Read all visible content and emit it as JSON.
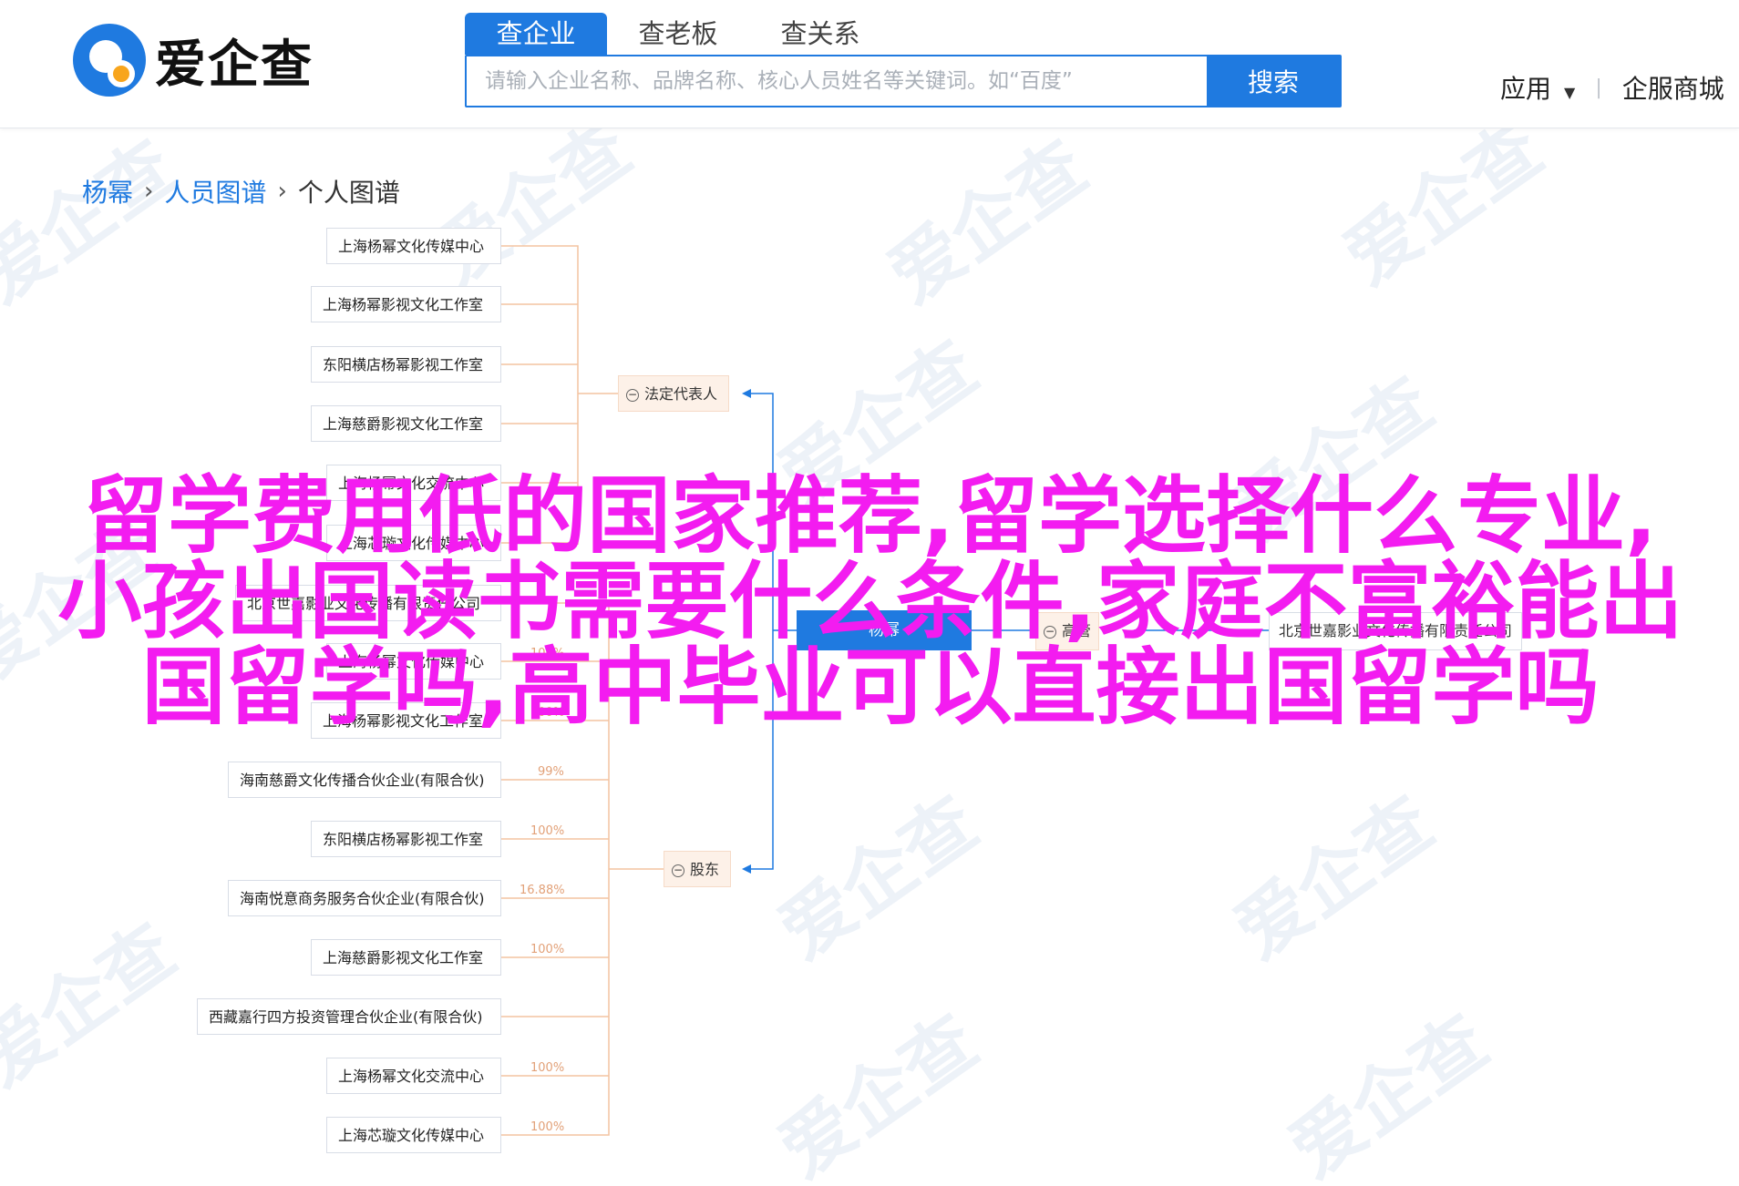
{
  "header": {
    "logo_text": "爱企查",
    "tabs": [
      {
        "label": "查企业",
        "active": true
      },
      {
        "label": "查老板",
        "active": false
      },
      {
        "label": "查关系",
        "active": false
      }
    ],
    "search": {
      "placeholder": "请输入企业名称、品牌名称、核心人员姓名等关键词。如“百度”",
      "button_label": "搜索"
    },
    "nav": {
      "apps_label": "应用",
      "enterprise_label": "企服商城"
    }
  },
  "breadcrumb": {
    "items": [
      "杨幂",
      "人员图谱",
      "个人图谱"
    ]
  },
  "watermark_text": "爱企查",
  "graph": {
    "groups": {
      "legal_rep": "法定代表人",
      "shareholder": "股东",
      "manager": "高管"
    },
    "legal_rep_nodes": [
      {
        "name": "上海杨幂文化传媒中心",
        "pct": ""
      },
      {
        "name": "上海杨幂影视文化工作室",
        "pct": ""
      },
      {
        "name": "东阳横店杨幂影视工作室",
        "pct": ""
      },
      {
        "name": "上海慈爵影视文化工作室",
        "pct": ""
      },
      {
        "name": "上海杨幂文化交流中心",
        "pct": ""
      },
      {
        "name": "上海芯璇文化传媒中心",
        "pct": ""
      }
    ],
    "shareholder_nodes": [
      {
        "name": "北京世嘉影业文化传播有限责任公司",
        "pct": ""
      },
      {
        "name": "上海杨幂文化传媒中心",
        "pct": "100%"
      },
      {
        "name": "上海杨幂影视文化工作室",
        "pct": "100%"
      },
      {
        "name": "海南慈爵文化传播合伙企业(有限合伙)",
        "pct": "99%"
      },
      {
        "name": "东阳横店杨幂影视工作室",
        "pct": "100%"
      },
      {
        "name": "海南悦意商务服务合伙企业(有限合伙)",
        "pct": "16.88%"
      },
      {
        "name": "上海慈爵影视文化工作室",
        "pct": "100%"
      },
      {
        "name": "西藏嘉行四方投资管理合伙企业(有限合伙)",
        "pct": ""
      },
      {
        "name": "上海杨幂文化交流中心",
        "pct": "100%"
      },
      {
        "name": "上海芯璇文化传媒中心",
        "pct": "100%"
      }
    ],
    "center": "杨幂",
    "right_node": "北京世嘉影业文化传播有限责任公司"
  },
  "overlay_title": {
    "lines": [
      "留学费用低的国家推荐,留学选择什么专业,",
      "小孩出国读书需要什么条件,家庭不富裕能出",
      "国留学吗,高中毕业可以直接出国留学吗"
    ]
  },
  "colors": {
    "brand_blue": "#1f7ae0",
    "logo_orange": "#f8a51c",
    "overlay_magenta": "#f31cf0",
    "connector_orange": "#f4c3a0"
  }
}
